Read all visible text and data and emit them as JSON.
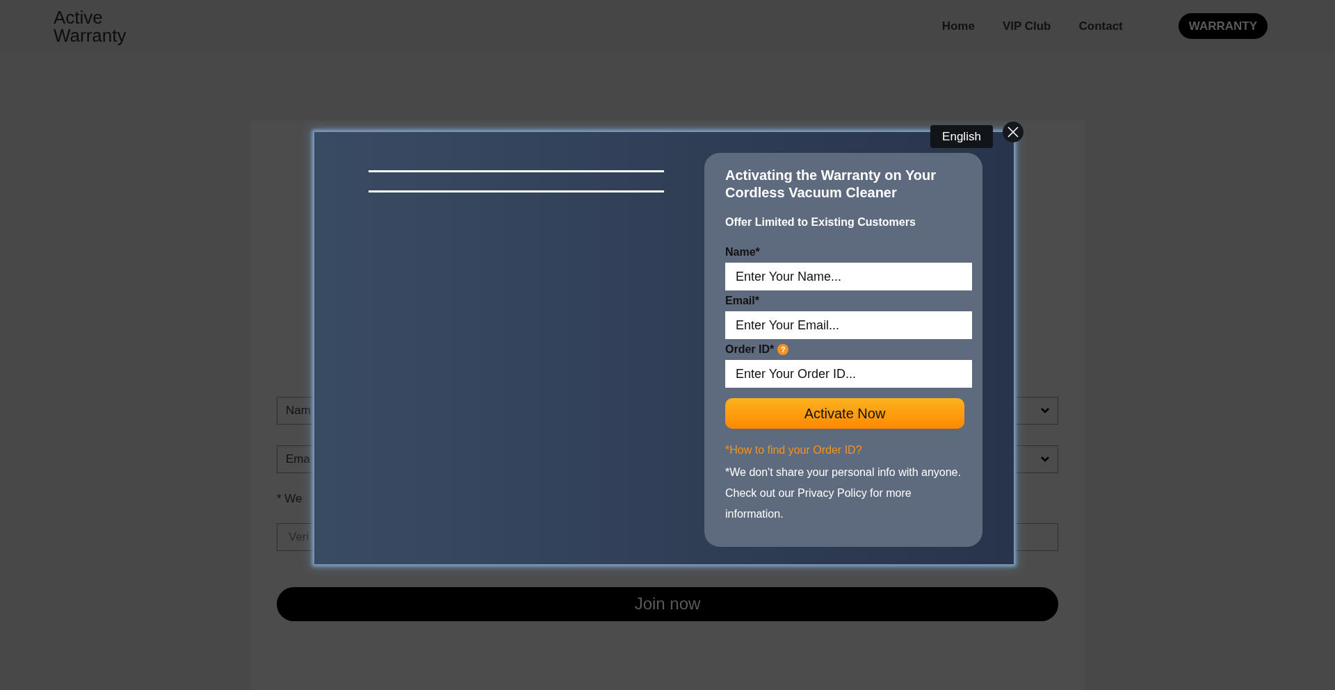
{
  "header": {
    "logo": [
      "Active",
      "Warranty"
    ],
    "nav": [
      "Home",
      "VIP Club",
      "Contact"
    ],
    "cta": "WARRANTY"
  },
  "background_form": {
    "fields": [
      {
        "kind": "select",
        "placeholder": "Nam"
      },
      {
        "kind": "select",
        "placeholder": "Ema"
      },
      {
        "kind": "note",
        "text": "* We"
      },
      {
        "kind": "input",
        "placeholder": "Veri"
      }
    ],
    "button": "Join now"
  },
  "modal": {
    "language": "English",
    "title": "Activating the Warranty on Your Cordless Vacuum Cleaner",
    "subtitle": "Offer Limited to Existing Customers",
    "fields": [
      {
        "label": "Name*",
        "placeholder": "Enter Your Name...",
        "help": false
      },
      {
        "label": "Email*",
        "placeholder": "Enter Your Email...",
        "help": false
      },
      {
        "label": "Order ID*",
        "placeholder": "Enter Your Order ID...",
        "help": true,
        "help_text": "?"
      }
    ],
    "button": "Activate Now",
    "link": "*How to find your Order ID?",
    "notes": [
      "*We don't share your personal info with anyone.",
      "Check out our Privacy Policy for more",
      "information."
    ]
  }
}
